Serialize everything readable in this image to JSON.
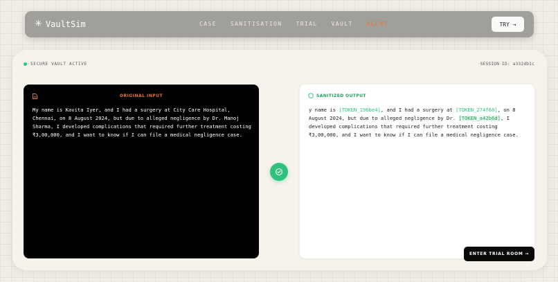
{
  "brand": {
    "icon": "✳",
    "name": "VaultSim"
  },
  "nav": {
    "links": [
      "CASE",
      "SANITISATION",
      "TRIAL",
      "VAULT",
      "AGENT"
    ],
    "active_index": 4,
    "try_button": "TRY →"
  },
  "status": {
    "text": "SECURE VAULT ACTIVE",
    "session": "SESSION ID: a332db1c"
  },
  "original": {
    "title": "ORIGINAL INPUT",
    "text": "My name is Kavita Iyer, and I had a surgery at City Care Hospital, Chennai, on 8 August 2024, but due to alleged negligence by Dr. Manoj Sharma, I developed complications that required further treatment costing ₹3,00,000, and I want to know if I can file a medical negligence case."
  },
  "sanitized": {
    "title": "SANITIZED OUTPUT",
    "segments": [
      {
        "text": "y name is ",
        "type": "text"
      },
      {
        "text": "[TOKEN_196be4]",
        "type": "token"
      },
      {
        "text": ", and I had a surgery at ",
        "type": "text"
      },
      {
        "text": "[TOKEN_274f60]",
        "type": "token"
      },
      {
        "text": ", on 8 August 2024, but due to alleged negligence by Dr. ",
        "type": "text"
      },
      {
        "text": "[TOKEN_a42b6d]",
        "type": "token-strong"
      },
      {
        "text": ", I developed complications that required further treatment costing ₹3,00,000, and I want to know if I can file a medical negligence case.",
        "type": "text"
      }
    ]
  },
  "enter_button": "ENTER TRIAL ROOM →",
  "colors": {
    "accent": "#e8773a",
    "green": "#2ec27e",
    "nav": "#a19f99"
  },
  "icons": {
    "doc": "document-icon",
    "shield": "shield-icon",
    "check": "check-icon"
  }
}
